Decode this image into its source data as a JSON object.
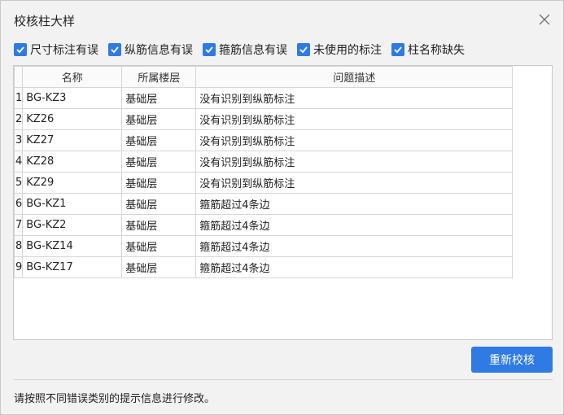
{
  "dialog": {
    "title": "校核柱大样",
    "footer_text": "请按照不同错误类别的提示信息进行修改。",
    "recheck_label": "重新校核"
  },
  "checks": [
    {
      "label": "尺寸标注有误",
      "checked": true
    },
    {
      "label": "纵筋信息有误",
      "checked": true
    },
    {
      "label": "箍筋信息有误",
      "checked": true
    },
    {
      "label": "未使用的标注",
      "checked": true
    },
    {
      "label": "柱名称缺失",
      "checked": true
    }
  ],
  "table": {
    "headers": [
      "名称",
      "所属楼层",
      "问题描述"
    ],
    "rows": [
      {
        "idx": "1",
        "name": "BG-KZ3",
        "floor": "基础层",
        "desc": "没有识别到纵筋标注"
      },
      {
        "idx": "2",
        "name": "KZ26",
        "floor": "基础层",
        "desc": "没有识别到纵筋标注"
      },
      {
        "idx": "3",
        "name": "KZ27",
        "floor": "基础层",
        "desc": "没有识别到纵筋标注"
      },
      {
        "idx": "4",
        "name": "KZ28",
        "floor": "基础层",
        "desc": "没有识别到纵筋标注"
      },
      {
        "idx": "5",
        "name": "KZ29",
        "floor": "基础层",
        "desc": "没有识别到纵筋标注"
      },
      {
        "idx": "6",
        "name": "BG-KZ1",
        "floor": "基础层",
        "desc": "箍筋超过4条边"
      },
      {
        "idx": "7",
        "name": "BG-KZ2",
        "floor": "基础层",
        "desc": "箍筋超过4条边"
      },
      {
        "idx": "8",
        "name": "BG-KZ14",
        "floor": "基础层",
        "desc": "箍筋超过4条边"
      },
      {
        "idx": "9",
        "name": "BG-KZ17",
        "floor": "基础层",
        "desc": "箍筋超过4条边"
      }
    ]
  },
  "colors": {
    "accent": "#2f7ae5",
    "background": "#f2f2f2"
  }
}
